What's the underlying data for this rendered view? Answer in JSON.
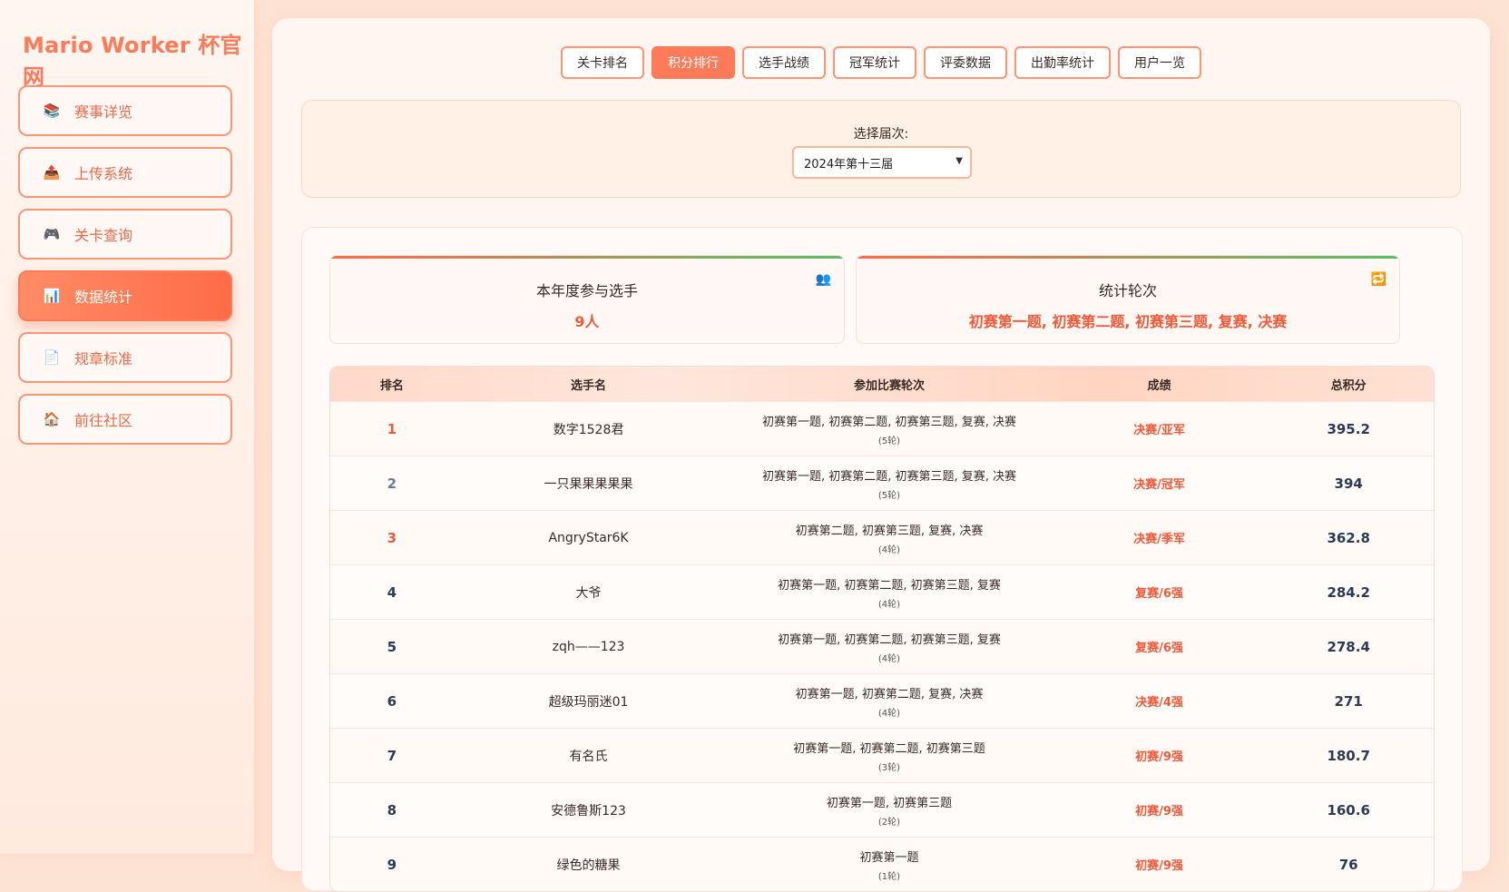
{
  "brand": "Mario Worker 杯官网",
  "nav": [
    {
      "label": "赛事详览",
      "icon": "books-icon",
      "glyph": "📚",
      "active": false
    },
    {
      "label": "上传系统",
      "icon": "upload-tray-icon",
      "glyph": "📤",
      "active": false
    },
    {
      "label": "关卡查询",
      "icon": "gamepad-icon",
      "glyph": "🎮",
      "active": false
    },
    {
      "label": "数据统计",
      "icon": "bar-chart-icon",
      "glyph": "📊",
      "active": true
    },
    {
      "label": "规章标准",
      "icon": "document-icon",
      "glyph": "📄",
      "active": false
    },
    {
      "label": "前往社区",
      "icon": "house-icon",
      "glyph": "🏠",
      "active": false
    }
  ],
  "tabs": [
    {
      "label": "关卡排名",
      "active": false
    },
    {
      "label": "积分排行",
      "active": true
    },
    {
      "label": "选手战绩",
      "active": false
    },
    {
      "label": "冠军统计",
      "active": false
    },
    {
      "label": "评委数据",
      "active": false
    },
    {
      "label": "出勤率统计",
      "active": false
    },
    {
      "label": "用户一览",
      "active": false
    }
  ],
  "season_selector": {
    "label": "选择届次:",
    "value": "2024年第十三届"
  },
  "stats": [
    {
      "title": "本年度参与选手",
      "value": "9人",
      "icon": "users-icon",
      "glyph": "👥"
    },
    {
      "title": "统计轮次",
      "value": "初赛第一题, 初赛第二题, 初赛第三题, 复赛, 决赛",
      "icon": "repeat-icon",
      "glyph": "🔁"
    }
  ],
  "table": {
    "headers": [
      "排名",
      "选手名",
      "参加比赛轮次",
      "成绩",
      "总积分"
    ],
    "rows": [
      {
        "rank": "1",
        "name": "数字1528君",
        "rounds": "初赛第一题, 初赛第二题, 初赛第三题, 复赛, 决赛",
        "count": "(5轮)",
        "result": "决赛/亚军",
        "total": "395.2"
      },
      {
        "rank": "2",
        "name": "一只果果果果果",
        "rounds": "初赛第一题, 初赛第二题, 初赛第三题, 复赛, 决赛",
        "count": "(5轮)",
        "result": "决赛/冠军",
        "total": "394"
      },
      {
        "rank": "3",
        "name": "AngryStar6K",
        "rounds": "初赛第二题, 初赛第三题, 复赛, 决赛",
        "count": "(4轮)",
        "result": "决赛/季军",
        "total": "362.8"
      },
      {
        "rank": "4",
        "name": "大爷",
        "rounds": "初赛第一题, 初赛第二题, 初赛第三题, 复赛",
        "count": "(4轮)",
        "result": "复赛/6强",
        "total": "284.2"
      },
      {
        "rank": "5",
        "name": "zqh——123",
        "rounds": "初赛第一题, 初赛第二题, 初赛第三题, 复赛",
        "count": "(4轮)",
        "result": "复赛/6强",
        "total": "278.4"
      },
      {
        "rank": "6",
        "name": "超级玛丽迷01",
        "rounds": "初赛第一题, 初赛第二题, 复赛, 决赛",
        "count": "(4轮)",
        "result": "决赛/4强",
        "total": "271"
      },
      {
        "rank": "7",
        "name": "有名氏",
        "rounds": "初赛第一题, 初赛第二题, 初赛第三题",
        "count": "(3轮)",
        "result": "初赛/9强",
        "total": "180.7"
      },
      {
        "rank": "8",
        "name": "安德鲁斯123",
        "rounds": "初赛第一题, 初赛第三题",
        "count": "(2轮)",
        "result": "初赛/9强",
        "total": "160.6"
      },
      {
        "rank": "9",
        "name": "绿色的糖果",
        "rounds": "初赛第一题",
        "count": "(1轮)",
        "result": "初赛/9强",
        "total": "76"
      }
    ]
  }
}
